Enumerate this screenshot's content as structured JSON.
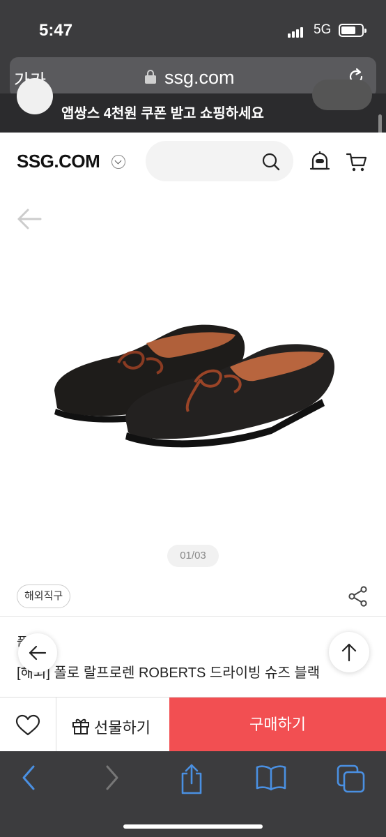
{
  "status_bar": {
    "time": "5:47",
    "network": "5G"
  },
  "browser": {
    "text_size_label": "가가",
    "url": "ssg.com"
  },
  "promo_banner": {
    "text": "앱쌍스 4천원 쿠폰 받고 쇼핑하세요"
  },
  "header": {
    "logo": "SSG.COM",
    "search_placeholder": ""
  },
  "product": {
    "image_pager": "01/03",
    "tag": "해외직구",
    "brand": "폴로",
    "title": "[해외] 폴로 랄프로렌 ROBERTS 드라이빙 슈즈 블랙"
  },
  "actions": {
    "gift_label": "선물하기",
    "buy_label": "구매하기"
  },
  "colors": {
    "buy_button": "#f24f52",
    "browser_chrome": "#3c3c3e",
    "safari_accent": "#4a90e2"
  }
}
